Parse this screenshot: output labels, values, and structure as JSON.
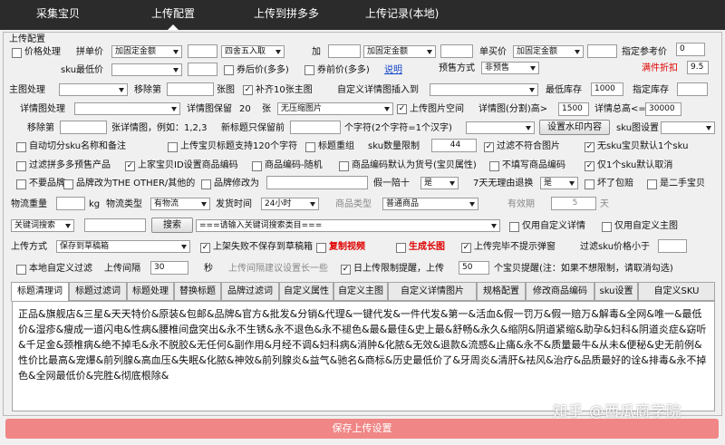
{
  "nav": {
    "tabs": [
      {
        "label": "采集宝贝"
      },
      {
        "label": "上传配置"
      },
      {
        "label": "上传到拼多多"
      },
      {
        "label": "上传记录(本地)"
      }
    ]
  },
  "form": {
    "title": "上传配置",
    "price_process": "价格处理",
    "pdd_price": "拼单价",
    "fixed_amount": "加固定金额",
    "rounding": "四舍五入取",
    "plus": "加",
    "single_price": "单买价",
    "ref_price": "指定参考价",
    "ref_price_value": "0",
    "sku_min_price": "sku最低价",
    "after_coupon": "券后价(多多)",
    "before_coupon": "券前价(多多)",
    "explain": "说明",
    "presale": "预售方式",
    "no_presale": "非预售",
    "discount": "满件折扣",
    "discount_value": "9.5",
    "main_image": "主图处理",
    "remove_nth": "移除第",
    "image_unit": "张图",
    "fill_main": "补齐10张主图",
    "custom_detail_insert": "自定义详情图插入到",
    "min_stock": "最低库存",
    "min_stock_value": "1000",
    "set_stock": "指定库存",
    "detail_process": "详情图处理",
    "detail_keep": "详情图保留",
    "detail_keep_value": "20",
    "sheets": "张",
    "no_thumb": "无压缩图片",
    "detail_space": "上传图片空间",
    "detail_split": "详情图(分割)高>",
    "detail_split_value": "1500",
    "detail_total": "详情总高<=",
    "detail_total_value": "30000",
    "remove_nth2": "移除第",
    "detail_example": "张详情图，例如：1,2,3",
    "new_title_keep": "新标题只保留前",
    "chars_note": "个字符(2个字符=1个汉字)",
    "watermark_btn": "设置水印内容",
    "sku_image": "sku图设置",
    "auto_cut": "自动切分sku名称和备注",
    "title_120": "上传宝贝标题支持120个字符",
    "title_reorg": "标题重组",
    "sku_limit": "sku数量限制",
    "sku_limit_value": "44",
    "filter_bad_images": "过滤不符合图片",
    "no_sku_upload": "无sku宝贝默认1个sku",
    "filter_presale": "过滤拼多多预售产品",
    "sku_id_code": "上家宝贝ID设置商品编码",
    "code_random": "商品编码-随机",
    "code_default": "商品编码默认为货号(宝贝属性)",
    "no_fill_code": "不填写商品编码",
    "only_one_sku": "仅1个sku默认取消",
    "no_brand": "不要品牌",
    "brand_other": "品牌改为THE OTHER/其他的",
    "brand_edit": "品牌修改为",
    "fake_one": "假一陪十",
    "fake_one_value": "是",
    "seven_day": "7天无理由退换",
    "seven_day_value": "是",
    "broken_pay": "坏了包赔",
    "second_hand": "是二手宝贝",
    "weight": "物流重量",
    "kg": "kg",
    "logistics_type": "物流类型",
    "logistics_value": "有物流",
    "ship_time": "发货时间",
    "ship_time_value": "24小时",
    "goods_type": "商品类型",
    "goods_type_value": "普通商品",
    "valid_period": "有效期",
    "valid_period_value": "5",
    "days": "天",
    "keyword_search": "关键词搜索",
    "search_btn": "搜索",
    "category_placeholder": "===请输入关键词搜索类目===",
    "only_custom_detail": "仅用自定义详情",
    "only_custom_main": "仅用自定义主图",
    "upload_mode": "上传方式",
    "upload_mode_value": "保存到草稿箱",
    "fail_no_draft": "上架失败不保存到草稿箱",
    "copy_video": "复制视频",
    "gen_long_image": "生成长图",
    "no_popup": "上传完毕不提示弹窗",
    "filter_sku_price": "过滤sku价格小于",
    "local_filter": "本地自定义过滤",
    "upload_interval": "上传间隔",
    "upload_interval_value": "30",
    "seconds": "秒",
    "interval_hint": "上传间隔建议设置长一些",
    "daily_limit": "日上传限制提醒，上传",
    "daily_limit_value": "50",
    "daily_limit_note": "个宝贝提醒(注：如果不想限制，请取消勾选)"
  },
  "tabs": [
    {
      "label": "标题清理词"
    },
    {
      "label": "标题过滤词"
    },
    {
      "label": "标题处理"
    },
    {
      "label": "替换标题"
    },
    {
      "label": "品牌过滤词"
    },
    {
      "label": "自定义属性"
    },
    {
      "label": "自定义主图"
    },
    {
      "label": "自定义详情图片"
    },
    {
      "label": "规格配置"
    },
    {
      "label": "修改商品编码"
    },
    {
      "label": "sku设置"
    },
    {
      "label": "自定义SKU"
    }
  ],
  "textarea_content": "正品&旗舰店&三星&天天特价&原装&包邮&品牌&官方&批发&分销&代理&一键代发&一件代发&第一&活血&假一罚万&假一赔万&解毒&全网&唯一&最低价&湿疹&瘦成一道闪电&性病&腰椎间盘突出&永不生锈&永不退色&永不褪色&最&最佳&史上最&舒畅&永久&缩阴&阴道紧缩&助孕&妇科&阴道炎症&窈听&千足金&颈椎病&绝不掉毛&永不脱胶&无任何&副作用&月经不调&妇科病&消肿&化脓&无效&退款&流感&止痛&永不&质量最牛&从未&便秘&史无前例&性价比最高&宠爆&前列腺&高血压&失眠&化脓&神效&前列腺炎&益气&驰名&商标&历史最低价了&牙周炎&清肝&祛风&治疗&品质最好的诠&排毒&永不掉色&全网最低价&完胜&彻底根除&",
  "save_label": "保存上传设置",
  "watermark": "知乎 @西瓜商学院"
}
